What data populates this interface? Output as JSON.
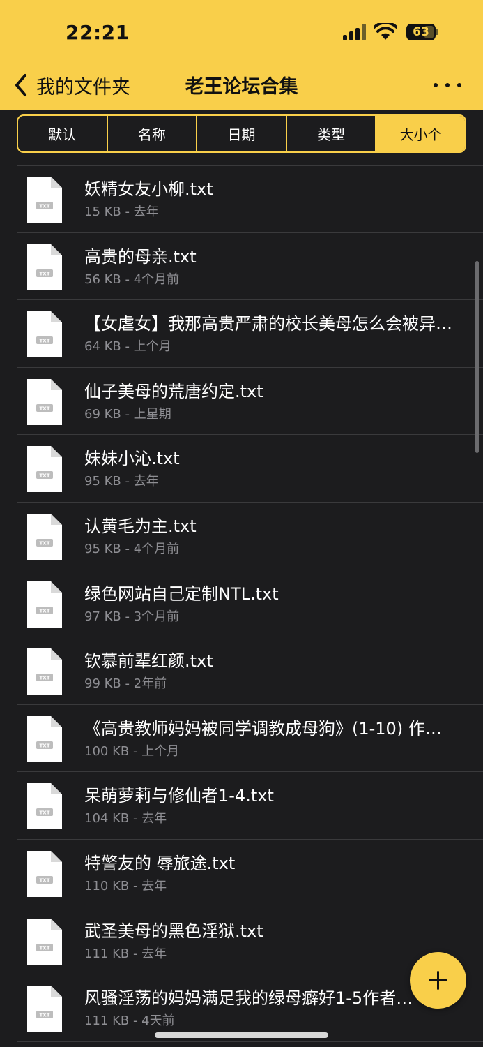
{
  "status_bar": {
    "time": "22:21",
    "battery": "63"
  },
  "nav": {
    "back_label": "我的文件夹",
    "title": "老王论坛合集"
  },
  "sort_tabs": [
    {
      "label": "默认",
      "active": false
    },
    {
      "label": "名称",
      "active": false
    },
    {
      "label": "日期",
      "active": false
    },
    {
      "label": "类型",
      "active": false
    },
    {
      "label": "大小个",
      "active": true
    }
  ],
  "files": [
    {
      "name": "妖精女友小柳.txt",
      "meta": "15 KB - 去年"
    },
    {
      "name": "高贵的母亲.txt",
      "meta": "56 KB - 4个月前"
    },
    {
      "name": "【女虐女】我那高贵严肃的校长美母怎么会被异…",
      "meta": "64 KB - 上个月"
    },
    {
      "name": "仙子美母的荒唐约定.txt",
      "meta": "69 KB - 上星期"
    },
    {
      "name": "妹妹小沁.txt",
      "meta": "95 KB - 去年"
    },
    {
      "name": "认黄毛为主.txt",
      "meta": "95 KB - 4个月前"
    },
    {
      "name": "绿色网站自己定制NTL.txt",
      "meta": "97 KB - 3个月前"
    },
    {
      "name": "钦慕前辈红颜.txt",
      "meta": "99 KB - 2年前"
    },
    {
      "name": "《高贵教师妈妈被同学调教成母狗》(1-10) 作…",
      "meta": "100 KB - 上个月"
    },
    {
      "name": "呆萌萝莉与修仙者1-4.txt",
      "meta": "104 KB - 去年"
    },
    {
      "name": "特警友的 辱旅途.txt",
      "meta": "110 KB - 去年"
    },
    {
      "name": "武圣美母的黑色淫狱.txt",
      "meta": "111 KB - 去年"
    },
    {
      "name": "风骚淫荡的妈妈满足我的绿母癖好1-5作者…",
      "meta": "111 KB - 4天前"
    }
  ],
  "file_icon_label": "TXT",
  "icons": {
    "back": "chevron-left-icon",
    "more": "ellipsis-icon",
    "add": "plus-icon",
    "file": "txt-file-icon"
  },
  "colors": {
    "accent": "#f9cf4a",
    "background": "#1c1c1e",
    "divider": "#3a3a3c",
    "secondary_text": "#8e8e93"
  }
}
